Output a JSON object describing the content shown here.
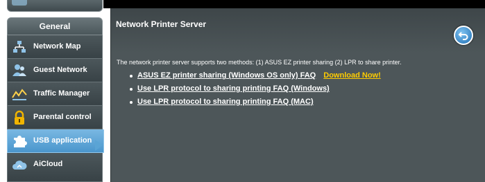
{
  "sidebar": {
    "header": "General",
    "items": [
      {
        "label": "Network Map",
        "icon": "network-map-icon"
      },
      {
        "label": "Guest Network",
        "icon": "guest-network-icon"
      },
      {
        "label": "Traffic Manager",
        "icon": "traffic-manager-icon"
      },
      {
        "label": "Parental control",
        "icon": "parental-control-icon"
      },
      {
        "label": "USB application",
        "icon": "usb-application-icon",
        "active": true
      },
      {
        "label": "AiCloud",
        "icon": "aicloud-icon"
      }
    ]
  },
  "main": {
    "title": "Network Printer Server",
    "description": "The network printer server supports two methods: (1) ASUS EZ printer sharing (2) LPR to share printer.",
    "faq": [
      {
        "label": "ASUS EZ printer sharing (Windows OS only) FAQ",
        "extra": "Download Now!"
      },
      {
        "label": "Use LPR protocol to sharing printing FAQ (Windows)"
      },
      {
        "label": "Use LPR protocol to sharing printing FAQ (MAC)"
      }
    ]
  },
  "colors": {
    "active_nav": "#5aa4d5",
    "download_link": "#ffcc00",
    "panel_bg": "#4d5659"
  }
}
